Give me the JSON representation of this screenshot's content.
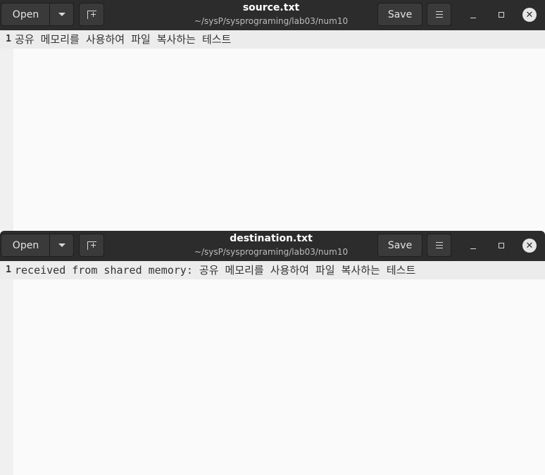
{
  "windows": [
    {
      "title": "source.txt",
      "path": "~/sysP/sysprograming/lab03/num10",
      "open_label": "Open",
      "save_label": "Save",
      "lines": [
        {
          "number": "1",
          "text": "공유 메모리를 사용하여 파일 복사하는 테스트"
        }
      ]
    },
    {
      "title": "destination.txt",
      "path": "~/sysP/sysprograming/lab03/num10",
      "open_label": "Open",
      "save_label": "Save",
      "lines": [
        {
          "number": "1",
          "text": "received from shared memory: 공유 메모리를 사용하여 파일 복사하는 테스트"
        }
      ]
    }
  ],
  "icons": {
    "dropdown": "chevron-down-icon",
    "new_tab": "new-document-icon",
    "menu": "hamburger-menu-icon",
    "minimize": "minimize-icon",
    "maximize": "maximize-icon",
    "close": "close-icon",
    "close_glyph": "✕"
  },
  "colors": {
    "headerbar": "#2c2c2c",
    "editor_bg": "#fafafa",
    "current_line": "#ececec"
  }
}
